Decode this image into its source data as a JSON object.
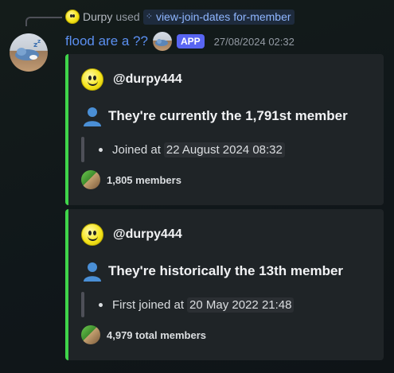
{
  "interaction": {
    "invoker": "Durpy",
    "used_text": "used",
    "command": "view-join-dates for-member"
  },
  "message": {
    "author": "flood are a ??",
    "badge": "APP",
    "timestamp": "27/08/2024 02:32"
  },
  "embeds": [
    {
      "author": "@durpy444",
      "title": "They're currently the 1,791st member",
      "bullet_label": "Joined at",
      "bullet_value": "22 August 2024 08:32",
      "footer": "1,805 members",
      "accent": "#3fd54a"
    },
    {
      "author": "@durpy444",
      "title": "They're historically the 13th member",
      "bullet_label": "First joined at",
      "bullet_value": "20 May 2022 21:48",
      "footer": "4,979 total members",
      "accent": "#3fd54a"
    }
  ],
  "icons": {
    "command": "slash-command-icon",
    "person": "bust-in-silhouette-icon",
    "author": "smiley-face-icon",
    "footer": "server-icon"
  }
}
